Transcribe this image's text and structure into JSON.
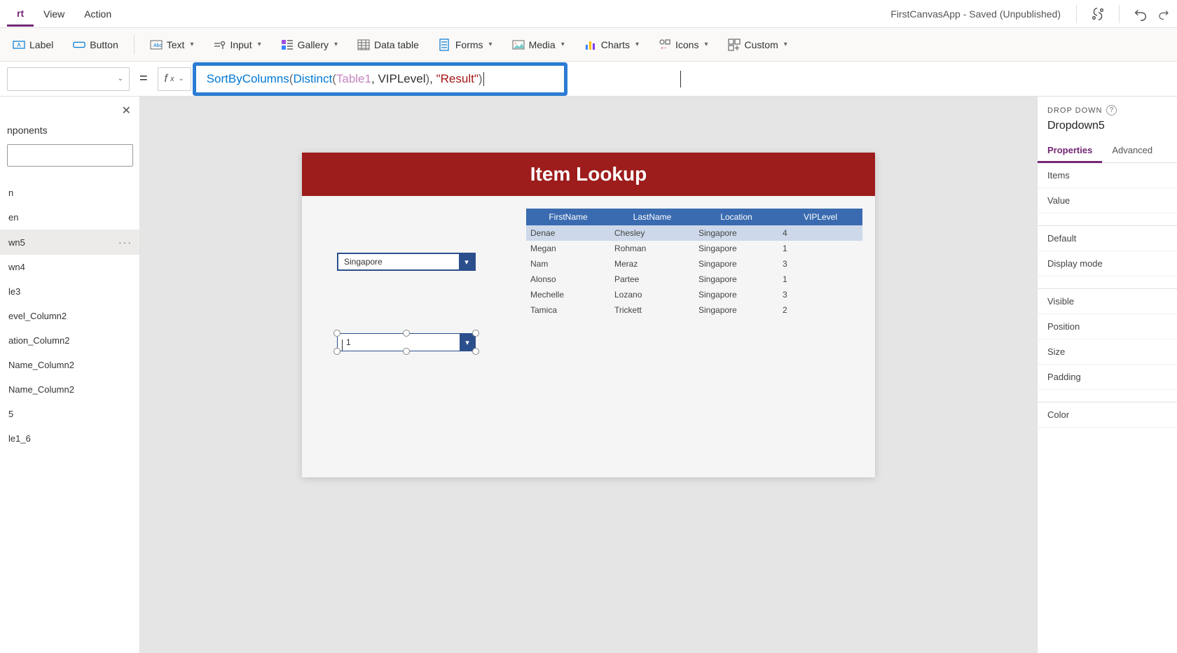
{
  "menu": {
    "items": [
      "rt",
      "View",
      "Action"
    ],
    "active_index": 0,
    "app_title": "FirstCanvasApp - Saved (Unpublished)"
  },
  "ribbon": {
    "label_btn": "Label",
    "button_btn": "Button",
    "text_btn": "Text",
    "input_btn": "Input",
    "gallery_btn": "Gallery",
    "datatable_btn": "Data table",
    "forms_btn": "Forms",
    "media_btn": "Media",
    "charts_btn": "Charts",
    "icons_btn": "Icons",
    "custom_btn": "Custom"
  },
  "formula": {
    "fn1": "SortByColumns",
    "fn2": "Distinct",
    "ident": "Table1",
    "arg1": "VIPLevel",
    "str": "\"Result\""
  },
  "tree": {
    "header": "nponents",
    "items": [
      "n",
      "en",
      "wn5",
      "wn4",
      "le3",
      "evel_Column2",
      "ation_Column2",
      "Name_Column2",
      "Name_Column2",
      "5",
      "le1_6"
    ],
    "selected_index": 2,
    "search_placeholder": ""
  },
  "canvas": {
    "title": "Item Lookup",
    "dropdown1_value": "Singapore",
    "dropdown2_value": "1",
    "table": {
      "headers": [
        "FirstName",
        "LastName",
        "Location",
        "VIPLevel"
      ],
      "rows": [
        [
          "Denae",
          "Chesley",
          "Singapore",
          "4"
        ],
        [
          "Megan",
          "Rohman",
          "Singapore",
          "1"
        ],
        [
          "Nam",
          "Meraz",
          "Singapore",
          "3"
        ],
        [
          "Alonso",
          "Partee",
          "Singapore",
          "1"
        ],
        [
          "Mechelle",
          "Lozano",
          "Singapore",
          "3"
        ],
        [
          "Tamica",
          "Trickett",
          "Singapore",
          "2"
        ]
      ]
    }
  },
  "props": {
    "type_label": "DROP DOWN",
    "control_name": "Dropdown5",
    "tabs": [
      "Properties",
      "Advanced"
    ],
    "active_tab": 0,
    "rows": [
      "Items",
      "Value"
    ],
    "rows2": [
      "Default",
      "Display mode"
    ],
    "rows3": [
      "Visible",
      "Position",
      "Size",
      "Padding"
    ],
    "rows4": [
      "Color"
    ]
  }
}
